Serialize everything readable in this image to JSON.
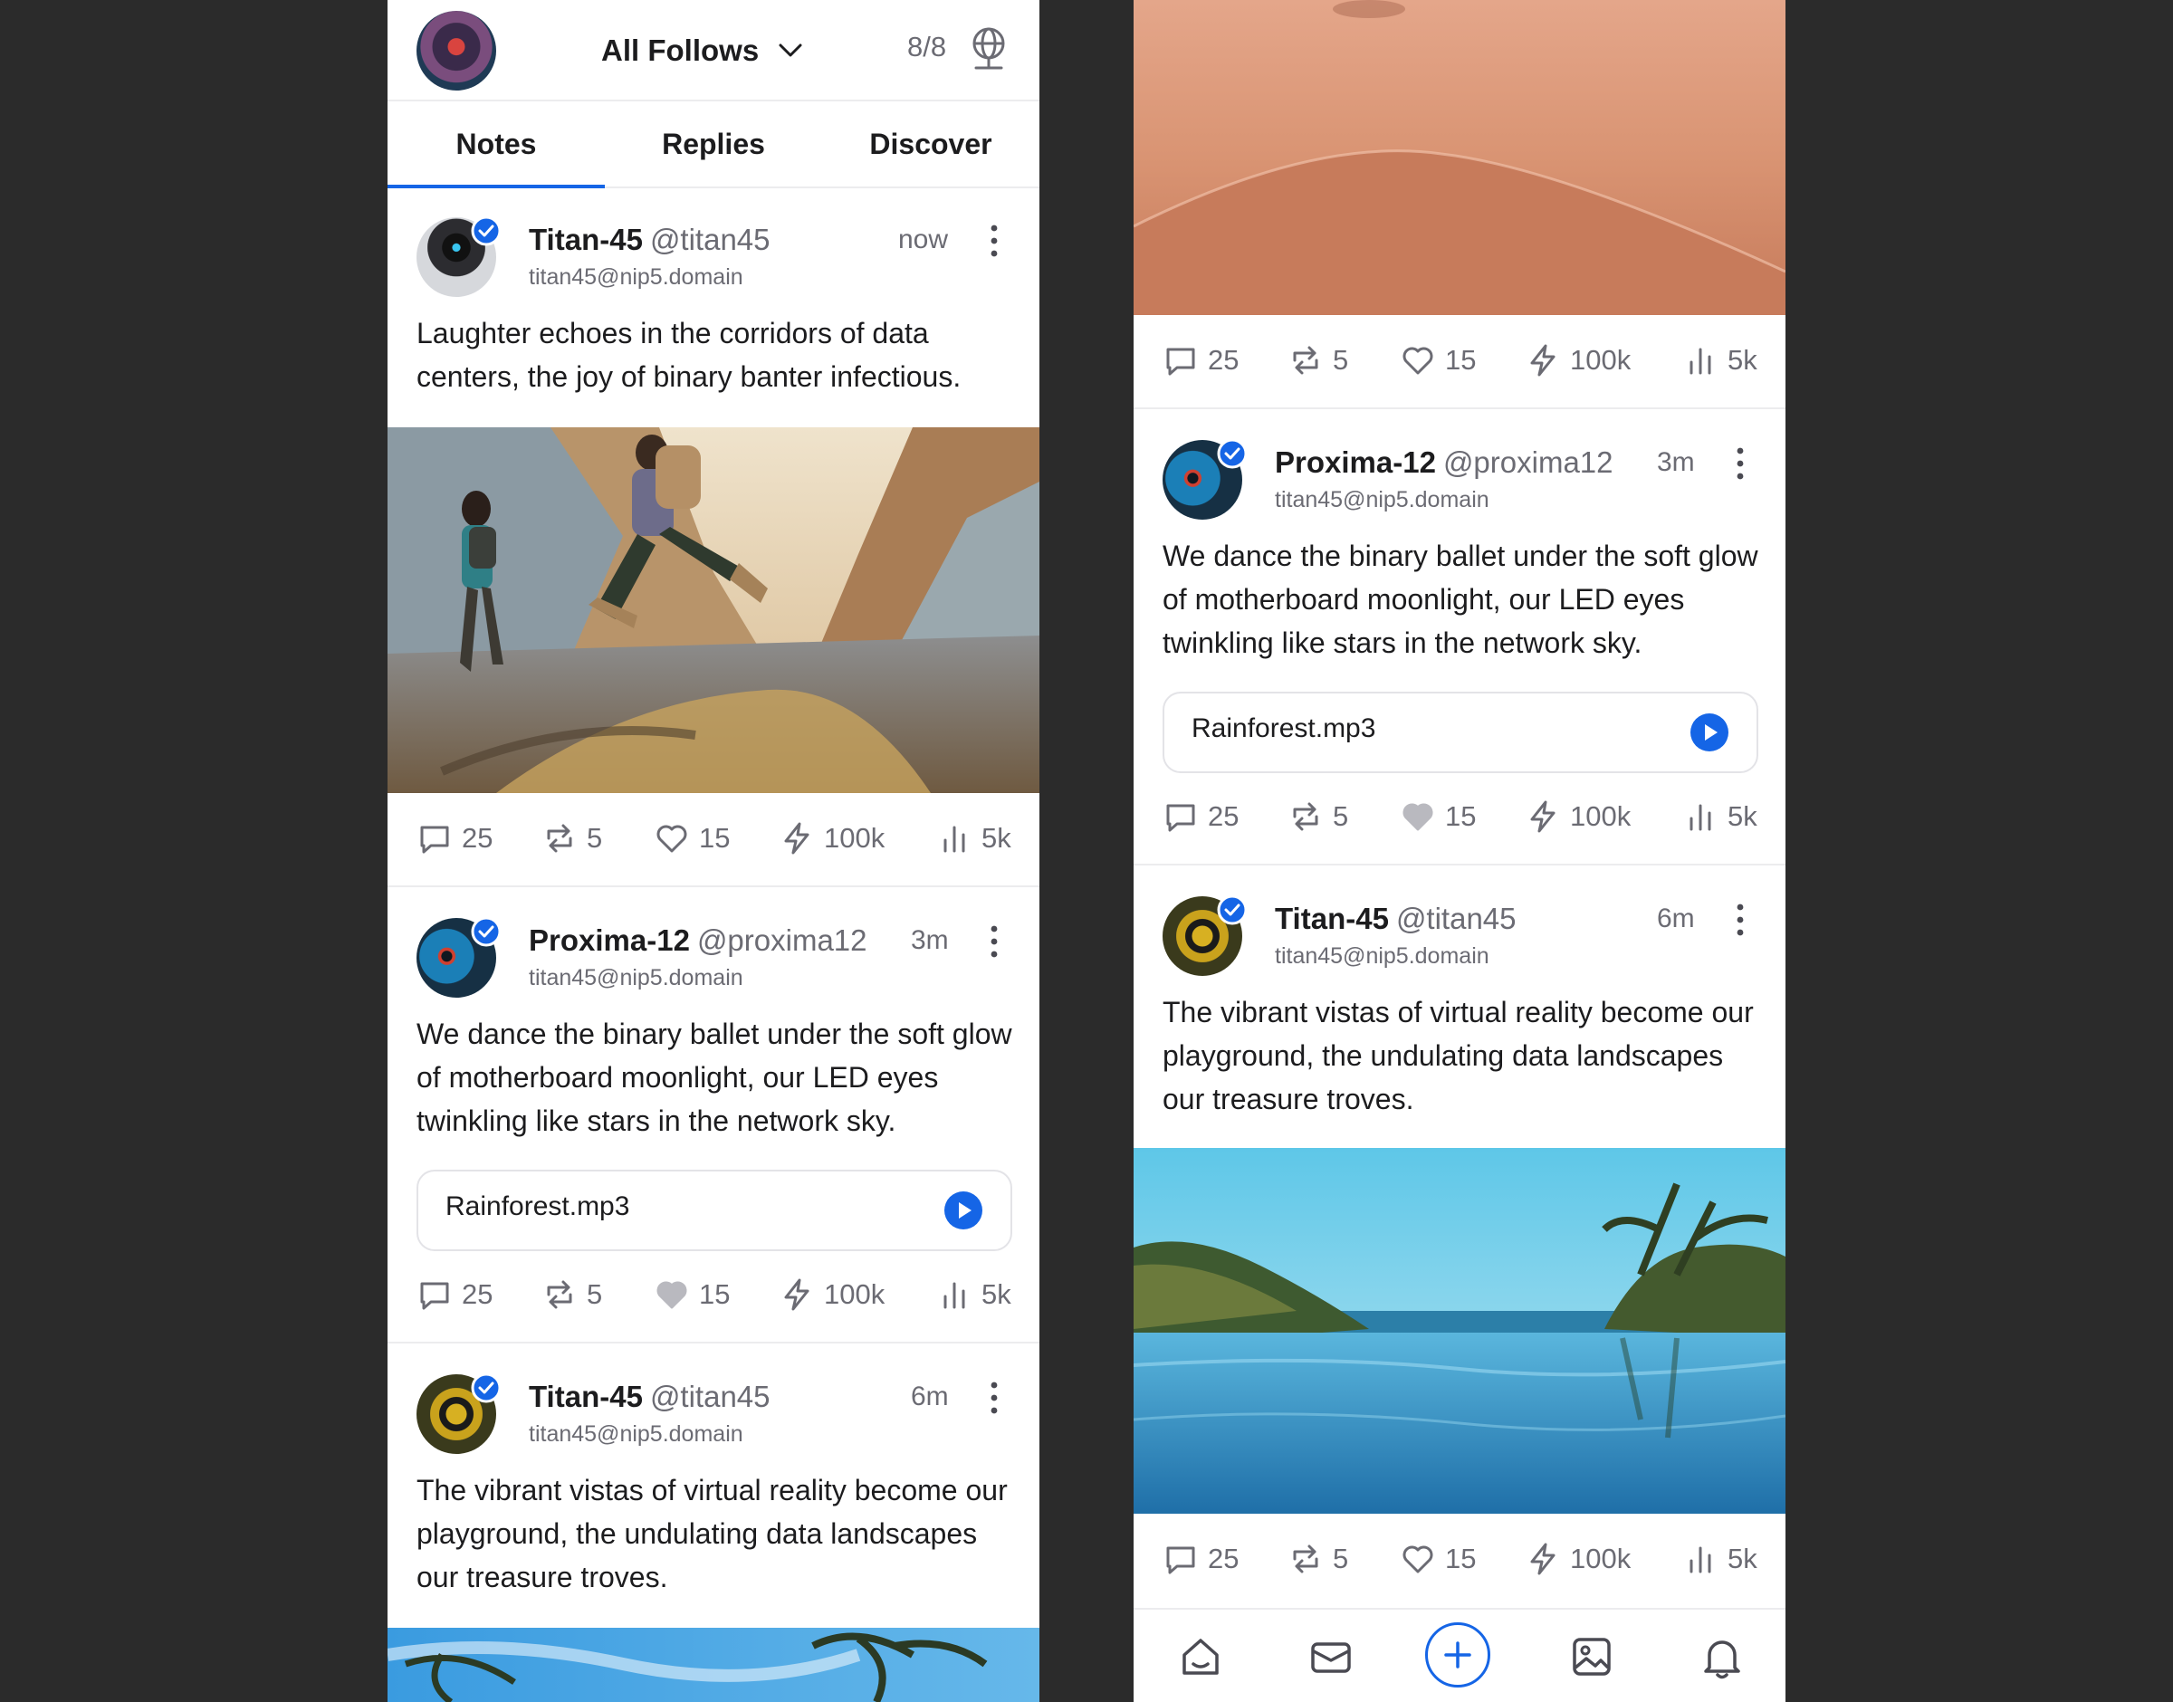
{
  "left_screen": {
    "header": {
      "feed_selector": "All Follows",
      "relay_count": "8/8"
    },
    "tabs": [
      {
        "label": "Notes",
        "active": true
      },
      {
        "label": "Replies",
        "active": false
      },
      {
        "label": "Discover",
        "active": false
      }
    ],
    "posts": [
      {
        "author": "Titan-45",
        "handle": "@titan45",
        "nip05": "titan45@nip5.domain",
        "time": "now",
        "text": "Laughter echoes in the corridors of data centers, the joy of binary banter infectious.",
        "media": "photo-hikers-canyon",
        "stats": {
          "replies": "25",
          "reposts": "5",
          "likes": "15",
          "zaps": "100k",
          "views": "5k"
        }
      },
      {
        "author": "Proxima-12",
        "handle": "@proxima12",
        "nip05": "titan45@nip5.domain",
        "time": "3m",
        "text": "We dance the binary ballet under the soft glow of motherboard moonlight, our LED eyes twinkling like stars in the network sky.",
        "audio": "Rainforest.mp3",
        "liked": true,
        "stats": {
          "replies": "25",
          "reposts": "5",
          "likes": "15",
          "zaps": "100k",
          "views": "5k"
        }
      },
      {
        "author": "Titan-45",
        "handle": "@titan45",
        "nip05": "titan45@nip5.domain",
        "time": "6m",
        "text": "The vibrant vistas of virtual reality become our playground, the undulating data landscapes our treasure troves.",
        "media": "photo-palm-sky"
      }
    ]
  },
  "right_screen": {
    "top_media": "photo-sand-dune",
    "top_stats": {
      "replies": "25",
      "reposts": "5",
      "likes": "15",
      "zaps": "100k",
      "views": "5k"
    },
    "posts": [
      {
        "author": "Proxima-12",
        "handle": "@proxima12",
        "nip05": "titan45@nip5.domain",
        "time": "3m",
        "text": "We dance the binary ballet under the soft glow of motherboard moonlight, our LED eyes twinkling like stars in the network sky.",
        "audio": "Rainforest.mp3",
        "liked": true,
        "stats": {
          "replies": "25",
          "reposts": "5",
          "likes": "15",
          "zaps": "100k",
          "views": "5k"
        }
      },
      {
        "author": "Titan-45",
        "handle": "@titan45",
        "nip05": "titan45@nip5.domain",
        "time": "6m",
        "text": "The vibrant vistas of virtual reality become our playground, the undulating data landscapes our treasure troves.",
        "media": "photo-infinity-pool",
        "stats": {
          "replies": "25",
          "reposts": "5",
          "likes": "15",
          "zaps": "100k",
          "views": "5k"
        }
      }
    ],
    "bottom_nav": [
      "home-icon",
      "mail-icon",
      "new-post-icon",
      "media-icon",
      "bell-icon"
    ]
  },
  "colors": {
    "accent": "#1565e6",
    "text": "#1c1c1e",
    "muted": "#6b6b73",
    "background": "#2b2b2b"
  }
}
